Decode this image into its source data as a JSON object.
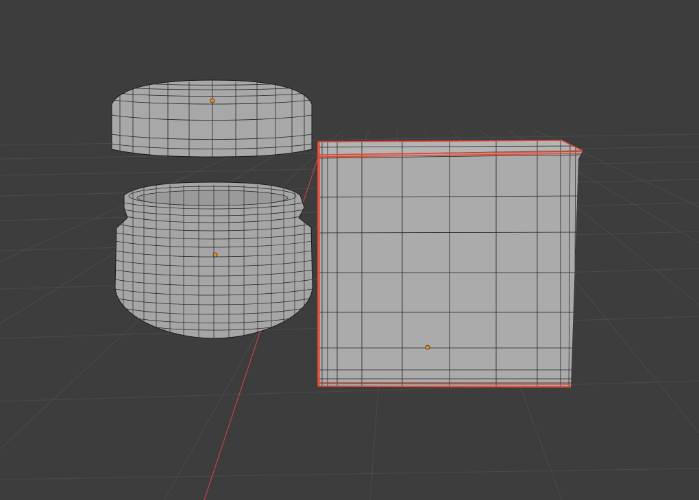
{
  "viewport": {
    "background_color": "#3d3d3d",
    "grid_line_color": "#4a4a4a",
    "x_axis_color": "#d04848",
    "mesh_fill_color": "#a9a9a9",
    "mesh_wire_color": "#1c1c1c",
    "selection_outline_color": "#e8482f",
    "origin_point_color": "#f08a24"
  },
  "objects": [
    {
      "name": "jar-lid",
      "type": "mesh",
      "selected": false,
      "icon": "origin-dot"
    },
    {
      "name": "jar-body",
      "type": "mesh",
      "selected": false,
      "icon": "origin-dot"
    },
    {
      "name": "cube",
      "type": "mesh",
      "selected": true,
      "icon": "origin-dot"
    }
  ]
}
